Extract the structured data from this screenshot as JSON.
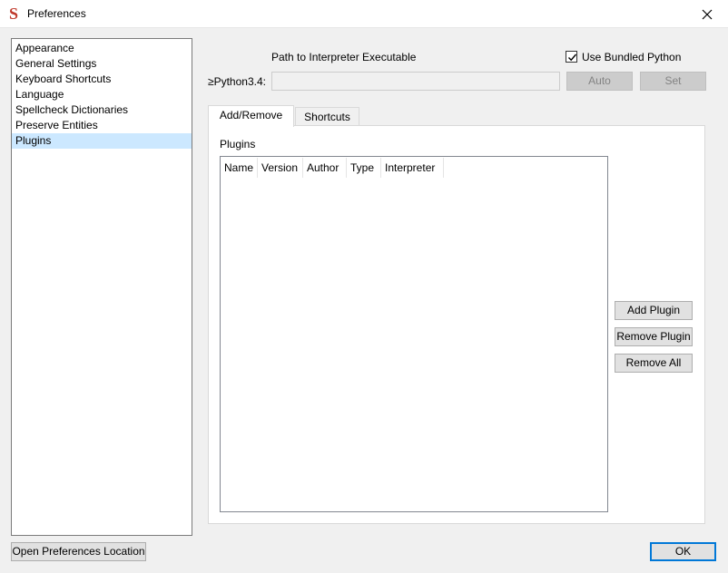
{
  "window": {
    "title": "Preferences",
    "app_icon_glyph": "S",
    "icons": {
      "app": "sigil-app-icon",
      "close": "close-icon"
    }
  },
  "sidebar": {
    "items": [
      {
        "label": "Appearance",
        "selected": false
      },
      {
        "label": "General Settings",
        "selected": false
      },
      {
        "label": "Keyboard Shortcuts",
        "selected": false
      },
      {
        "label": "Language",
        "selected": false
      },
      {
        "label": "Spellcheck Dictionaries",
        "selected": false
      },
      {
        "label": "Preserve Entities",
        "selected": false
      },
      {
        "label": "Plugins",
        "selected": true
      }
    ],
    "selected_color": "#cce8ff"
  },
  "interpreter": {
    "path_label": "Path to Interpreter Executable",
    "version_label": "≥Python3.4:",
    "path_value": "",
    "auto_label": "Auto",
    "set_label": "Set",
    "bundled_label": "Use Bundled Python",
    "bundled_checked": true
  },
  "tabs": [
    {
      "label": "Add/Remove",
      "active": true
    },
    {
      "label": "Shortcuts",
      "active": false
    }
  ],
  "plugins": {
    "section_label": "Plugins",
    "columns": [
      "Name",
      "Version",
      "Author",
      "Type",
      "Interpreter"
    ],
    "rows": [],
    "add_label": "Add Plugin",
    "remove_label": "Remove Plugin",
    "remove_all_label": "Remove All"
  },
  "footer": {
    "open_location_label": "Open Preferences Location",
    "ok_label": "OK"
  },
  "colors": {
    "accent": "#0078d7",
    "button_bg": "#e1e1e1",
    "disabled_bg": "#cccccc"
  }
}
